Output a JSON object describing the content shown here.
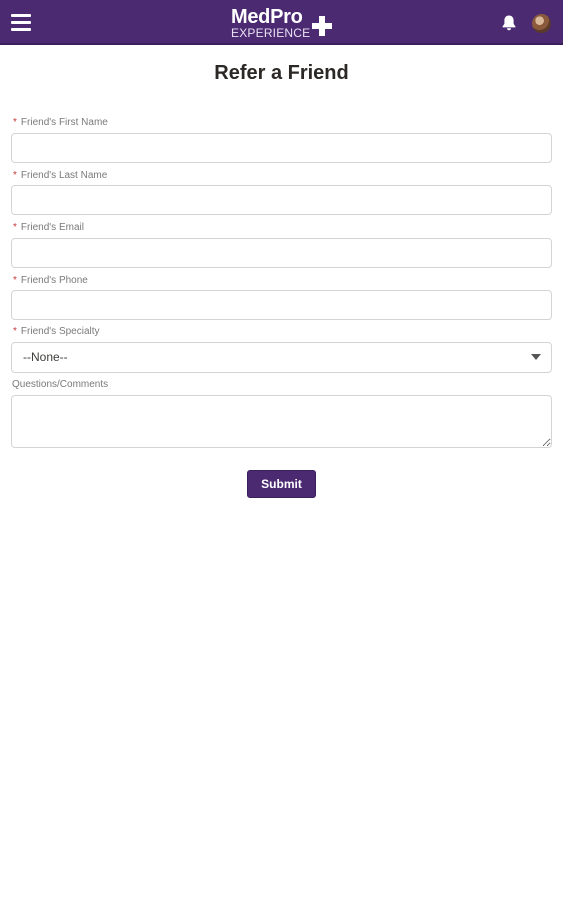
{
  "header": {
    "logo_main": "MedPro",
    "logo_sub": "EXPERIENCE",
    "menu_icon": "hamburger-menu-icon",
    "notification_icon": "bell-icon",
    "profile_icon": "avatar",
    "brand_color": "#4b2a72"
  },
  "page": {
    "title": "Refer a Friend"
  },
  "form": {
    "required_mark": "*",
    "first_name_label": "Friend's First Name",
    "first_name_value": "",
    "last_name_label": "Friend's Last Name",
    "last_name_value": "",
    "email_label": "Friend's Email",
    "email_value": "",
    "phone_label": "Friend's Phone",
    "phone_value": "",
    "specialty_label": "Friend's Specialty",
    "specialty_selected": "--None--",
    "comments_label": "Questions/Comments",
    "comments_value": "",
    "submit_label": "Submit"
  }
}
